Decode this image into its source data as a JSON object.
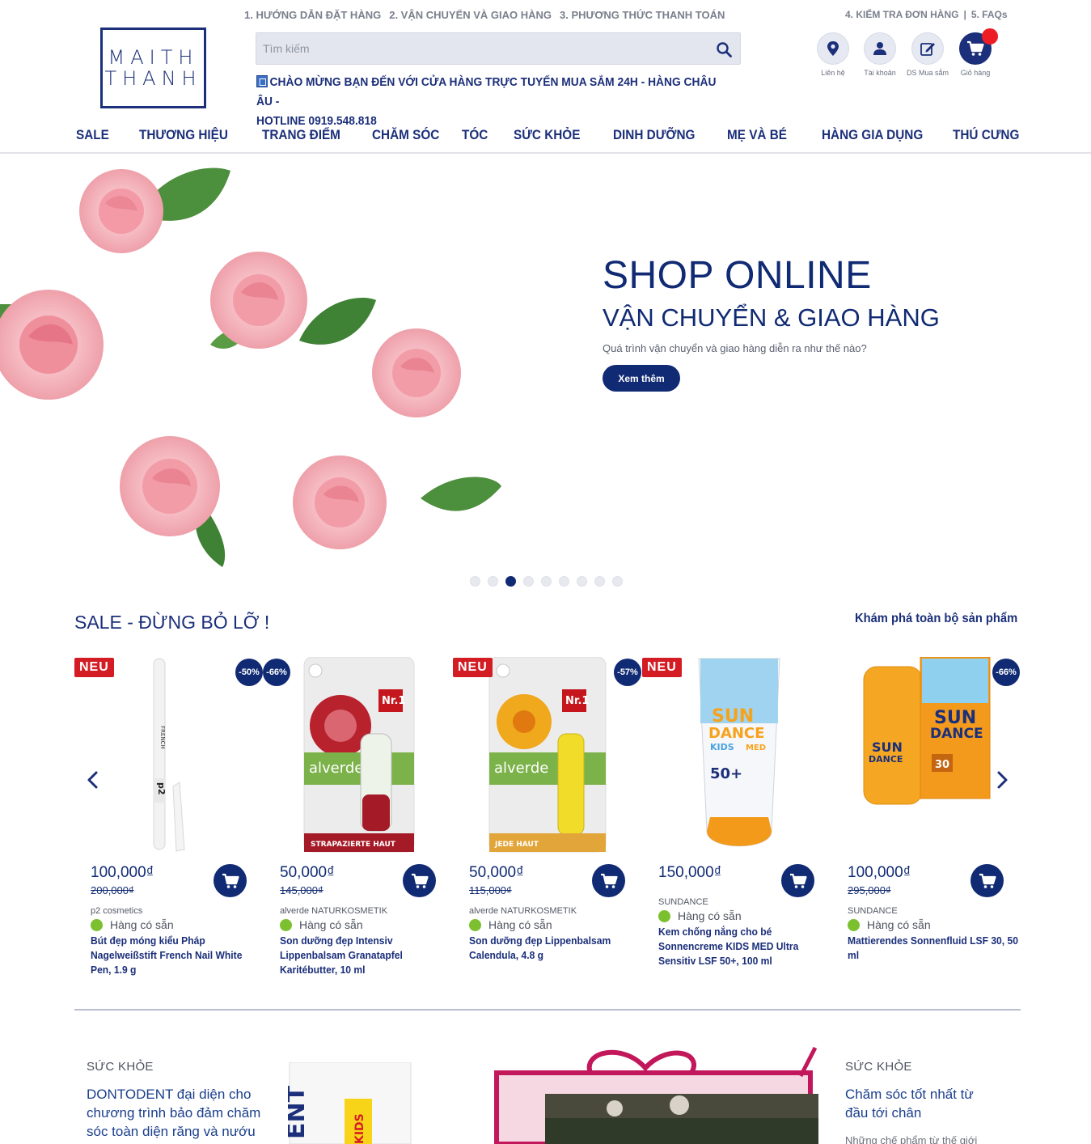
{
  "logo": {
    "line1": "MAITH",
    "line2": "THANH"
  },
  "top_links": [
    "1. HƯỚNG DẪN ĐẶT HÀNG",
    "2. VẬN CHUYỂN VÀ GIAO HÀNG",
    "3. PHƯƠNG THỨC THANH TOÁN"
  ],
  "top_links_right": {
    "item1": "4. KIỂM TRA ĐƠN HÀNG",
    "separator": "|",
    "item2": "5. FAQs"
  },
  "search": {
    "placeholder": "Tìm kiếm",
    "icon": "search-icon"
  },
  "welcome": {
    "line1": "CHÀO MỪNG BẠN ĐẾN VỚI CỬA HÀNG TRỰC TUYẾN MUA SẮM 24H - HÀNG CHÂU ÂU -",
    "line2": "HOTLINE 0919.548.818"
  },
  "header_icons": [
    {
      "label": "Liên hệ",
      "icon": "location-pin-icon"
    },
    {
      "label": "Tài khoản",
      "icon": "user-icon"
    },
    {
      "label": "DS Mua sắm",
      "icon": "edit-list-icon"
    },
    {
      "label": "Giỏ hàng",
      "icon": "shopping-cart-icon"
    }
  ],
  "nav": [
    "SALE",
    "THƯƠNG HIỆU",
    "TRANG ĐIỂM",
    "CHĂM SÓC",
    "TÓC",
    "SỨC KHỎE",
    "DINH DƯỠNG",
    "MẸ VÀ BÉ",
    "HÀNG GIA DỤNG",
    "THÚ CƯNG"
  ],
  "hero": {
    "title": "SHOP ONLINE",
    "subtitle": "VẬN CHUYỂN & GIAO HÀNG",
    "description": "Quá trình vận chuyển và giao hàng diễn ra như thế nào?",
    "button": "Xem thêm",
    "slide_count": 9,
    "active_slide": 3
  },
  "sale": {
    "title": "SALE - ĐỪNG BỎ LỠ !",
    "explore_link": "Khám phá toàn bộ sản phẩm",
    "products": [
      {
        "badge": "NEU",
        "discount": "-50%",
        "price": "100,000₫",
        "old_price": "200,000₫",
        "brand": "p2 cosmetics",
        "stock": "Hàng có sẵn",
        "name": "Bút đẹp móng kiểu Pháp Nagelweißstift French Nail White Pen, 1.9 g"
      },
      {
        "badge": "",
        "discount": "-66%",
        "price": "50,000₫",
        "old_price": "145,000₫",
        "brand": "alverde NATURKOSMETIK",
        "stock": "Hàng có sẵn",
        "name": "Son dưỡng đẹp Intensiv Lippenbalsam Granatapfel Karitébutter, 10 ml"
      },
      {
        "badge": "NEU",
        "discount": "-57%",
        "price": "50,000₫",
        "old_price": "115,000₫",
        "brand": "alverde NATURKOSMETIK",
        "stock": "Hàng có sẵn",
        "name": "Son dưỡng đẹp Lippenbalsam Calendula, 4.8 g"
      },
      {
        "badge": "NEU",
        "discount": "",
        "price": "150,000₫",
        "old_price": "",
        "brand": "SUNDANCE",
        "stock": "Hàng có sẵn",
        "name": "Kem chống nắng cho bé Sonnencreme KIDS MED Ultra Sensitiv LSF 50+, 100 ml"
      },
      {
        "badge": "",
        "discount": "-66%",
        "price": "100,000₫",
        "old_price": "295,000₫",
        "brand": "SUNDANCE",
        "stock": "Hàng có sẵn",
        "name": "Mattierendes Sonnenfluid LSF 30, 50 ml"
      }
    ]
  },
  "articles": [
    {
      "category": "SỨC KHỎE",
      "title": "DONTODENT đại diện cho chương trình bảo đảm chăm sóc toàn diện răng và nướu"
    },
    {
      "category": "SỨC KHỎE",
      "title": "Chăm sóc tốt nhất từ đầu tới chân",
      "description": "Những chế phẩm từ thế giới"
    }
  ],
  "colors": {
    "brand": "#1b2f7a",
    "sale_badge": "#d41c24",
    "in_stock": "#7cc02f",
    "cart_alert": "#ee1c25"
  }
}
